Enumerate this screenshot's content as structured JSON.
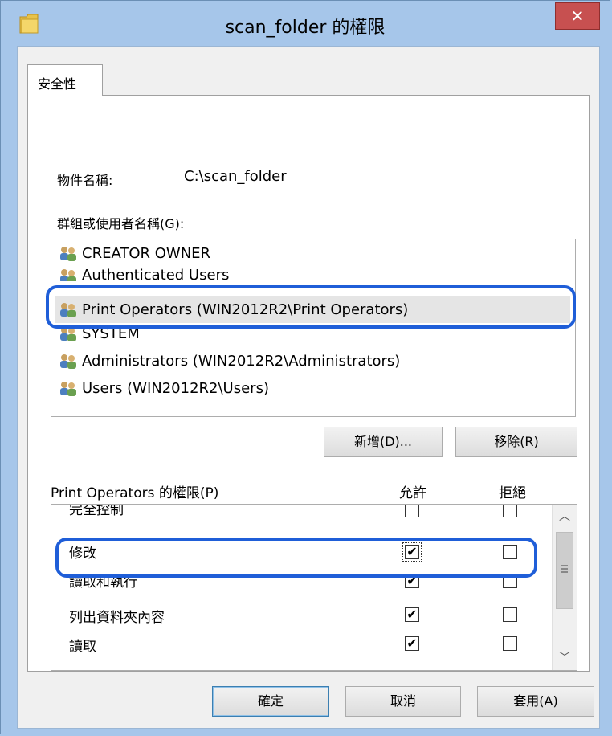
{
  "window": {
    "title": "scan_folder 的權限",
    "close_label": "✕"
  },
  "tabs": [
    {
      "label": "安全性"
    }
  ],
  "object_name": {
    "label": "物件名稱:",
    "value": "C:\\scan_folder"
  },
  "groups": {
    "label": "群組或使用者名稱(G):",
    "items": [
      {
        "label": "CREATOR OWNER"
      },
      {
        "label": "Authenticated Users"
      },
      {
        "label": "Print Operators (WIN2012R2\\Print Operators)",
        "selected": true
      },
      {
        "label": "SYSTEM"
      },
      {
        "label": "Administrators (WIN2012R2\\Administrators)"
      },
      {
        "label": "Users (WIN2012R2\\Users)"
      }
    ],
    "highlight_color": "#1f5ed8"
  },
  "buttons": {
    "add": "新增(D)...",
    "remove": "移除(R)",
    "ok": "確定",
    "cancel": "取消",
    "apply": "套用(A)"
  },
  "permissions": {
    "label": "Print Operators 的權限(P)",
    "allow_header": "允許",
    "deny_header": "拒絕",
    "rows": [
      {
        "label": "完全控制",
        "allow": false,
        "deny": false
      },
      {
        "label": "修改",
        "allow": true,
        "deny": false,
        "highlighted": true
      },
      {
        "label": "讀取和執行",
        "allow": true,
        "deny": false
      },
      {
        "label": "列出資料夾內容",
        "allow": true,
        "deny": false
      },
      {
        "label": "讀取",
        "allow": true,
        "deny": false
      }
    ],
    "check_mark": "✔"
  },
  "icons": {
    "folder": "folder-icon",
    "user_group": "user-group-icon",
    "scroll_up": "chevron-up-icon",
    "scroll_down": "chevron-down-icon"
  },
  "colors": {
    "title_bg": "#a6c6ea",
    "close_bg": "#c75050",
    "accent": "#1f5ed8"
  }
}
